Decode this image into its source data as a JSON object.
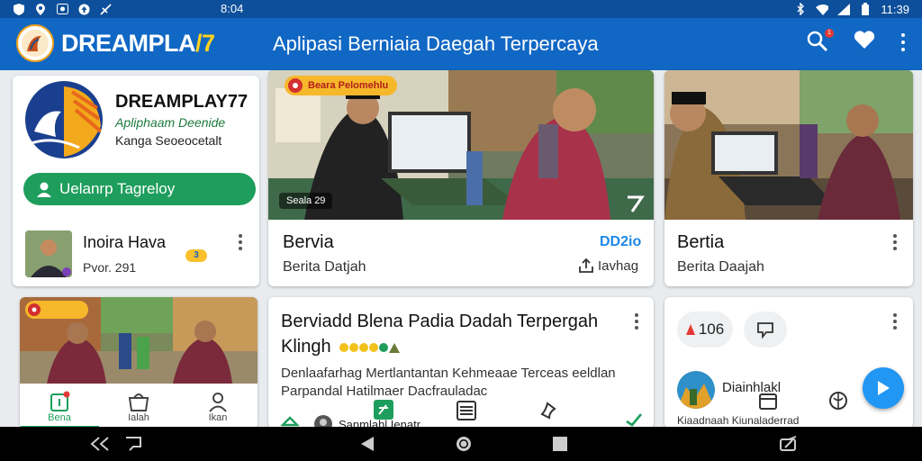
{
  "status_bar": {
    "time_center": "8:04",
    "time_right": "11:39"
  },
  "app_bar": {
    "brand_main": "DREAMPLA",
    "brand_accent": "/7",
    "title": "Aplipasi Berniaia Daegah Terpercaya",
    "notification_badge": "1"
  },
  "profile_card": {
    "name": "DREAMPLAY77",
    "tagline": "Apliphaam Deenide",
    "subtitle": "Kanga Seoeocetalt",
    "cta_label": "Uelanrp Tagreloy",
    "user_name": "Inoira Hava",
    "user_meta": "Pvor. 291",
    "user_badge": "3"
  },
  "news_card_1": {
    "badge": "Beara Pelomehlu",
    "image_caption": "Seala 29",
    "title": "Bervia",
    "tag": "DD2io",
    "subtitle": "Berita Datjah",
    "share_label": "Iavhag"
  },
  "news_card_2": {
    "title": "Bertia",
    "subtitle": "Berita Daajah"
  },
  "feature_card": {
    "headline_line1": "Berviadd Blena Padia Dadah Terpergah",
    "headline_line2": "Klingh",
    "body_line1": "Denlaafarhag Mertlantantan Kehmeaae Terceas eeldlan",
    "body_line2": "Parpandal Hatilmaer Dacfrauladac",
    "footer_label": "Sanmlahl Ienatr"
  },
  "small_card": {
    "bottom_tabs": [
      "Bena",
      "Ialah",
      "Ikan"
    ]
  },
  "right_card": {
    "chip_count": "106",
    "author": "Diainhlakl",
    "footer_text": "Kiaadnaah Kiunaladerrad"
  },
  "colors": {
    "app_bar": "#1167c4",
    "status_bar": "#0d4f9a",
    "accent_green": "#1e9e5c",
    "accent_orange": "#f2a21b",
    "fab_blue": "#2196f3"
  }
}
